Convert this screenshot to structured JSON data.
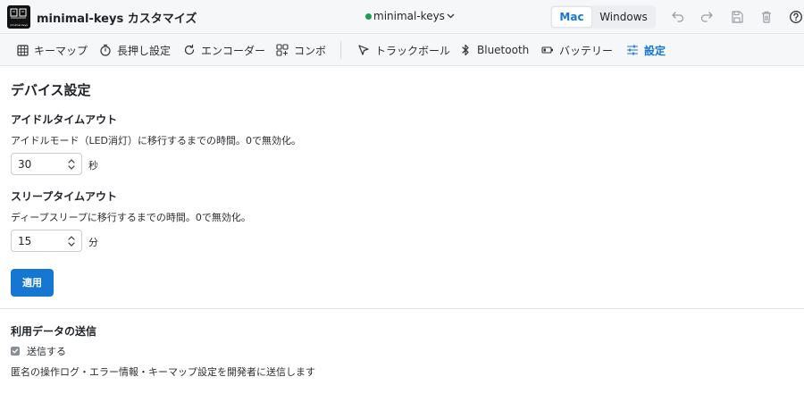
{
  "header": {
    "logo_text": "minimal keys",
    "title": "minimal-keys カスタマイズ",
    "device": "minimal-keys",
    "os_options": [
      "Mac",
      "Windows"
    ],
    "os_selected": "Mac",
    "colors": {
      "status": "#1a9e52",
      "accent": "#1677d2"
    },
    "icons": [
      "undo-icon",
      "redo-icon",
      "save-icon",
      "trash-icon",
      "help-icon"
    ]
  },
  "tabs": [
    {
      "label": "キーマップ",
      "icon": "grid-icon"
    },
    {
      "label": "長押し設定",
      "icon": "timer-icon"
    },
    {
      "label": "エンコーダー",
      "icon": "rotate-icon"
    },
    {
      "label": "コンボ",
      "icon": "combo-icon"
    },
    {
      "label": "トラックボール",
      "icon": "cursor-icon"
    },
    {
      "label": "Bluetooth",
      "icon": "bluetooth-icon"
    },
    {
      "label": "バッテリー",
      "icon": "battery-icon"
    },
    {
      "label": "設定",
      "icon": "sliders-icon",
      "active": true
    }
  ],
  "main": {
    "title": "デバイス設定",
    "idle": {
      "label": "アイドルタイムアウト",
      "desc": "アイドルモード（LED消灯）に移行するまでの時間。0で無効化。",
      "value": "30",
      "unit": "秒"
    },
    "sleep": {
      "label": "スリープタイムアウト",
      "desc": "ディープスリープに移行するまでの時間。0で無効化。",
      "value": "15",
      "unit": "分"
    },
    "apply_label": "適用",
    "telemetry": {
      "title": "利用データの送信",
      "checkbox_label": "送信する",
      "checked": true,
      "desc": "匿名の操作ログ・エラー情報・キーマップ設定を開発者に送信します"
    }
  }
}
